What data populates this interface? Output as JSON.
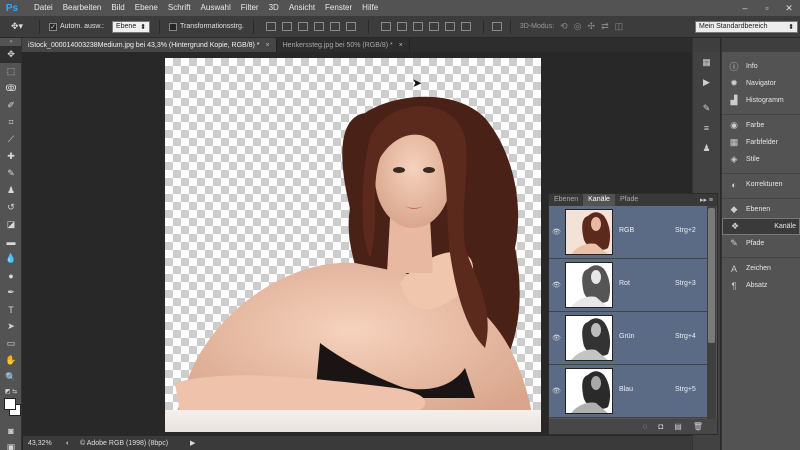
{
  "app": {
    "logo": "Ps"
  },
  "menu": [
    "Datei",
    "Bearbeiten",
    "Bild",
    "Ebene",
    "Schrift",
    "Auswahl",
    "Filter",
    "3D",
    "Ansicht",
    "Fenster",
    "Hilfe"
  ],
  "window_controls": [
    "–",
    "▫",
    "✕"
  ],
  "options": {
    "auto_select_label": "Autom. ausw.:",
    "auto_select_checked": "✓",
    "auto_select_value": "Ebene",
    "transform_label": "Transformationsstrg.",
    "mode3d_label": "3D-Modus:",
    "workspace_value": "Mein Standardbereich"
  },
  "tabs": [
    {
      "label": "iStock_000014003238Medium.jpg bei 43,3% (Hintergrund Kopie, RGB/8) *",
      "close": "×"
    },
    {
      "label": "Henkerssteg.jpg bei 50% (RGB/8) *",
      "close": "×"
    }
  ],
  "status": {
    "zoom": "43,32%",
    "profile": "© Adobe RGB (1998) (8bpc)",
    "arrow": "▶"
  },
  "dock": {
    "items": [
      {
        "label": "Info",
        "icon": "info-icon",
        "glyph": "ⓘ"
      },
      {
        "label": "Navigator",
        "icon": "navigator-icon",
        "glyph": "✹"
      },
      {
        "label": "Histogramm",
        "icon": "histogram-icon",
        "glyph": "▟"
      },
      {
        "label": "Farbe",
        "icon": "color-icon",
        "glyph": "◉"
      },
      {
        "label": "Farbfelder",
        "icon": "swatches-icon",
        "glyph": "▦"
      },
      {
        "label": "Stile",
        "icon": "styles-icon",
        "glyph": "◈"
      },
      {
        "label": "Korrekturen",
        "icon": "adjustments-icon",
        "glyph": "◐"
      },
      {
        "label": "Ebenen",
        "icon": "layers-icon",
        "glyph": "◆"
      },
      {
        "label": "Kanäle",
        "icon": "channels-icon",
        "glyph": "❖"
      },
      {
        "label": "Pfade",
        "icon": "paths-icon",
        "glyph": "✎"
      },
      {
        "label": "Zeichen",
        "icon": "character-icon",
        "glyph": "A"
      },
      {
        "label": "Absatz",
        "icon": "paragraph-icon",
        "glyph": "¶"
      }
    ]
  },
  "channels_panel": {
    "tabs": [
      "Ebenen",
      "Kanäle",
      "Pfade"
    ],
    "channels": [
      {
        "name": "RGB",
        "shortcut": "Strg+2"
      },
      {
        "name": "Rot",
        "shortcut": "Strg+3"
      },
      {
        "name": "Grün",
        "shortcut": "Strg+4"
      },
      {
        "name": "Blau",
        "shortcut": "Strg+5"
      }
    ]
  }
}
